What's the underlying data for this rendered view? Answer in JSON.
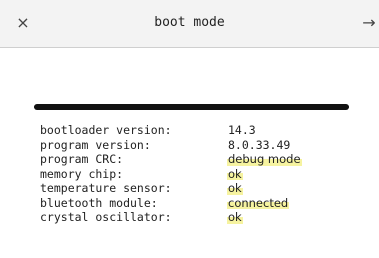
{
  "window": {
    "title": "boot mode",
    "close_icon": "×",
    "next_icon": "→"
  },
  "progress": {
    "value_fraction": 1.0
  },
  "info": [
    {
      "label": "bootloader version:",
      "value": "14.3",
      "highlight": false
    },
    {
      "label": "program version:",
      "value": "8.0.33.49",
      "highlight": false
    },
    {
      "label": "program CRC:",
      "value": "debug mode",
      "highlight": true
    },
    {
      "label": "memory chip:",
      "value": "ok",
      "highlight": true
    },
    {
      "label": "temperature sensor:",
      "value": "ok",
      "highlight": true
    },
    {
      "label": "bluetooth module:",
      "value": "connected",
      "highlight": true
    },
    {
      "label": "crystal oscillator:",
      "value": "ok",
      "highlight": true
    }
  ],
  "colors": {
    "highlight": "#f6f3a0",
    "text": "#222222",
    "titlebar": "#f3f3f3"
  }
}
